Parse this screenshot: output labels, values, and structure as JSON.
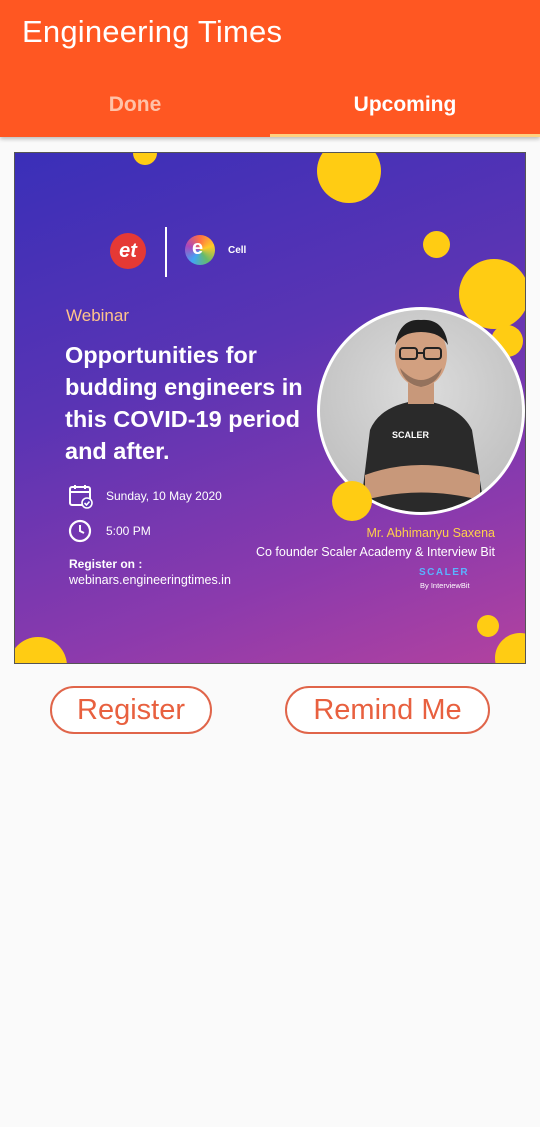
{
  "app": {
    "title": "Engineering Times"
  },
  "tabs": [
    {
      "label": "Done",
      "active": false
    },
    {
      "label": "Upcoming",
      "active": true
    }
  ],
  "poster": {
    "logo_et": "et",
    "logo_ecell": "Cell",
    "kicker": "Webinar",
    "headline": "Opportunities for budding engineers in this COVID-19 period and after.",
    "date": "Sunday, 10 May 2020",
    "time": "5:00 PM",
    "register_label": "Register on :",
    "register_url": "webinars.engineeringtimes.in",
    "speaker_name": "Mr. Abhimanyu Saxena",
    "speaker_role": "Co founder Scaler Academy & Interview Bit",
    "brand": "SCALER",
    "brand_sub": "By InterviewBit",
    "shirt_text": "SCALER"
  },
  "actions": {
    "register": "Register",
    "remind": "Remind Me"
  },
  "colors": {
    "appbar": "#ff5722",
    "accent": "#e8603f",
    "tab_indicator": "#ffd180",
    "poster_yellow": "#ffcc13"
  }
}
